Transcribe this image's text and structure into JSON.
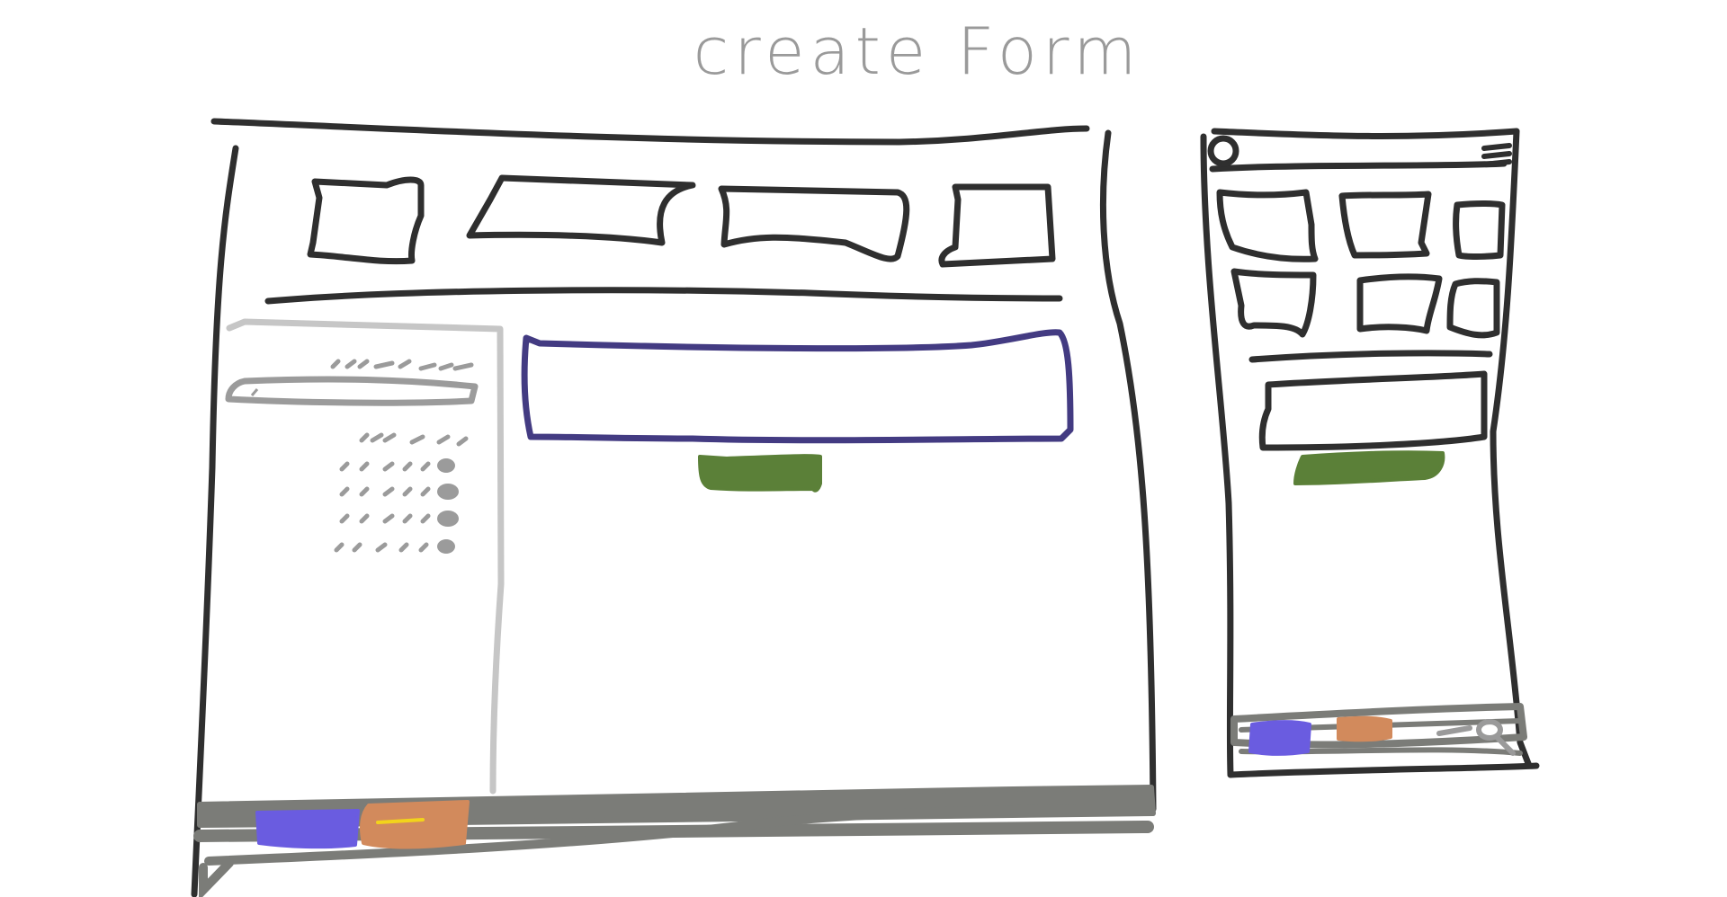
{
  "title": "create Form",
  "colors": {
    "ink": "#2f2f2f",
    "sidebar_outline": "#c6c6c6",
    "sidebar_marks": "#9b9b9b",
    "form_input_outline": "#433b82",
    "submit_button": "#5b8038",
    "footer_bar": "#7b7c78",
    "footer_blue": "#6a5ce0",
    "footer_orange": "#d28a5c",
    "footer_yellow": "#f2d31b"
  },
  "desktop": {
    "nav_tiles": 4,
    "sidebar_rows": 4
  },
  "mobile": {
    "nav_tiles": 6
  },
  "icons": {
    "avatar": "circle-icon",
    "menu": "hamburger-menu-icon",
    "search": "search-icon"
  }
}
